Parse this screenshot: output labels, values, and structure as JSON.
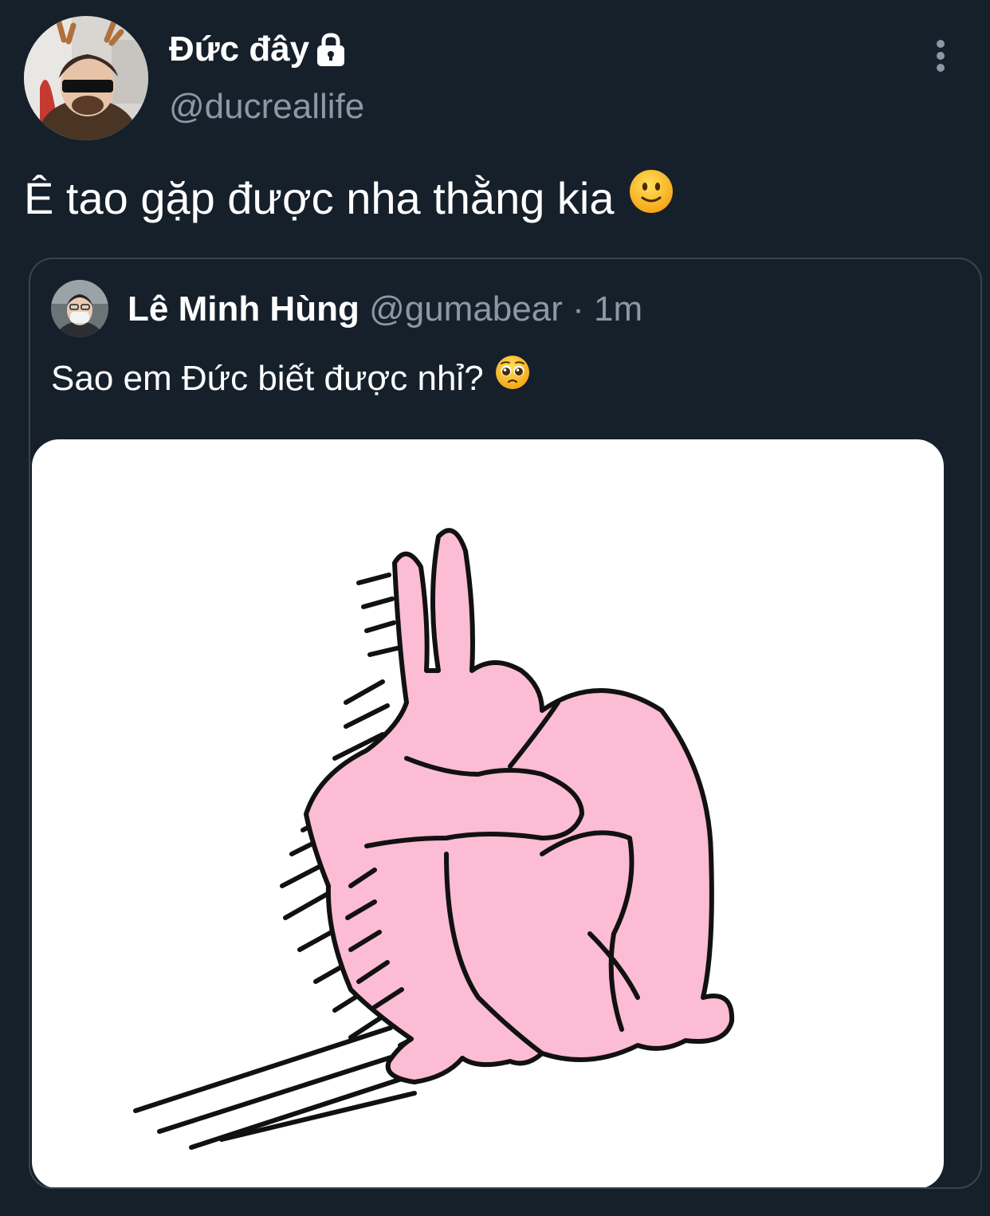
{
  "tweet": {
    "display_name": "Đức đây",
    "handle": "@ducreallife",
    "text": "Ê tao gặp được nha thằng kia",
    "protected": true
  },
  "quoted_tweet": {
    "display_name": "Lê Minh Hùng",
    "handle": "@gumabear",
    "separator": "·",
    "timestamp": "1m",
    "text": "Sao em Đức biết được nhỉ?",
    "media": "pink-rabbit-sticker"
  },
  "icons": {
    "lock": "lock-icon",
    "more": "more-vertical-icon",
    "smile_emoji": "slightly-smiling-face-emoji",
    "pleading_emoji": "pleading-face-emoji"
  },
  "colors": {
    "background": "#16202b",
    "secondary_text": "#8b98a5",
    "border": "#38444d",
    "rabbit_pink": "#fbbcd4"
  }
}
